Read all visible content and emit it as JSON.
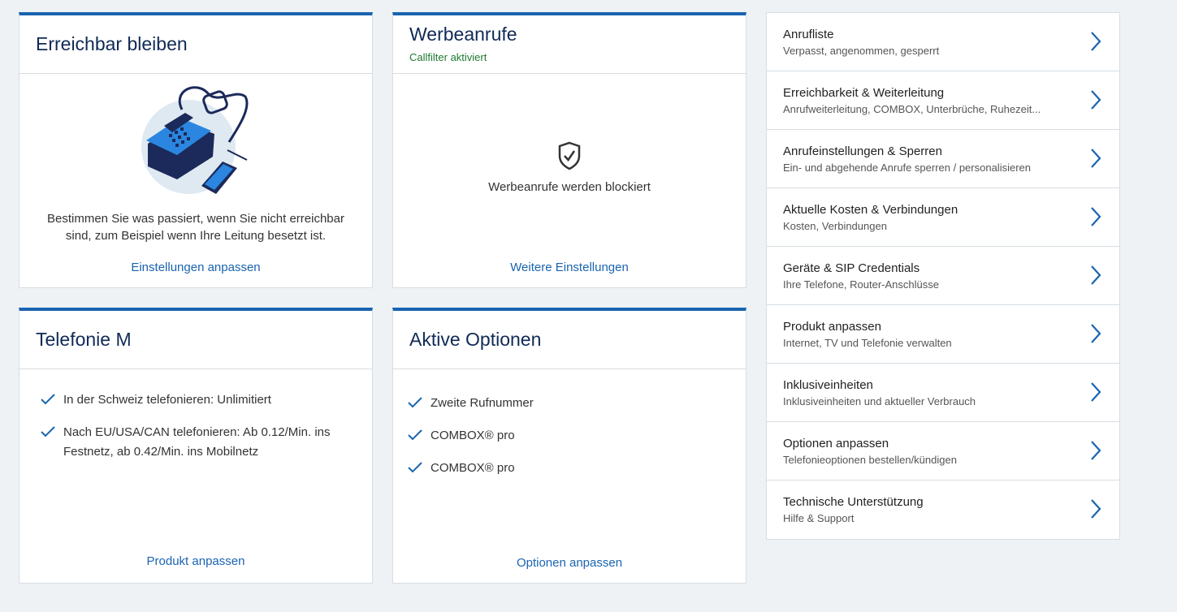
{
  "reachability": {
    "title": "Erreichbar bleiben",
    "text_line1": "Bestimmen Sie was passiert, wenn Sie nicht erreichbar",
    "text_line2": "sind, zum Beispiel wenn Ihre Leitung besetzt ist.",
    "link": "Einstellungen anpassen"
  },
  "ads_calls": {
    "title": "Werbeanrufe",
    "status": "Callfilter aktiviert",
    "message": "Werbeanrufe werden blockiert",
    "link": "Weitere Einstellungen",
    "icon": "shield-check-icon"
  },
  "plan": {
    "title": "Telefonie M",
    "items": [
      {
        "line1": "In der Schweiz telefonieren: Unlimitiert",
        "line2": ""
      },
      {
        "line1": "Nach EU/USA/CAN telefonieren: Ab 0.12/Min. ins",
        "line2": "Festnetz, ab 0.42/Min. ins Mobilnetz"
      }
    ],
    "link": "Produkt anpassen"
  },
  "options": {
    "title": "Aktive Optionen",
    "items": [
      "Zweite Rufnummer",
      "COMBOX® pro",
      "COMBOX® pro"
    ],
    "link": "Optionen anpassen"
  },
  "nav": {
    "items": [
      {
        "title": "Anrufliste",
        "desc": "Verpasst, angenommen, gesperrt"
      },
      {
        "title": "Erreichbarkeit & Weiterleitung",
        "desc": "Anrufweiterleitung, COMBOX, Unterbrüche, Ruhezeit..."
      },
      {
        "title": "Anrufeinstellungen & Sperren",
        "desc": "Ein- und abgehende Anrufe sperren / personalisieren"
      },
      {
        "title": "Aktuelle Kosten & Verbindungen",
        "desc": "Kosten, Verbindungen"
      },
      {
        "title": "Geräte & SIP Credentials",
        "desc": "Ihre Telefone, Router-Anschlüsse"
      },
      {
        "title": "Produkt anpassen",
        "desc": "Internet, TV und Telefonie verwalten"
      },
      {
        "title": "Inklusiveinheiten",
        "desc": "Inklusiveinheiten und aktueller Verbrauch"
      },
      {
        "title": "Optionen anpassen",
        "desc": "Telefonieoptionen bestellen/kündigen"
      },
      {
        "title": "Technische Unterstützung",
        "desc": "Hilfe & Support"
      }
    ]
  },
  "colors": {
    "accent": "#1a64b0",
    "title": "#102a56",
    "status_green": "#1e7a32",
    "background": "#eef2f5"
  }
}
